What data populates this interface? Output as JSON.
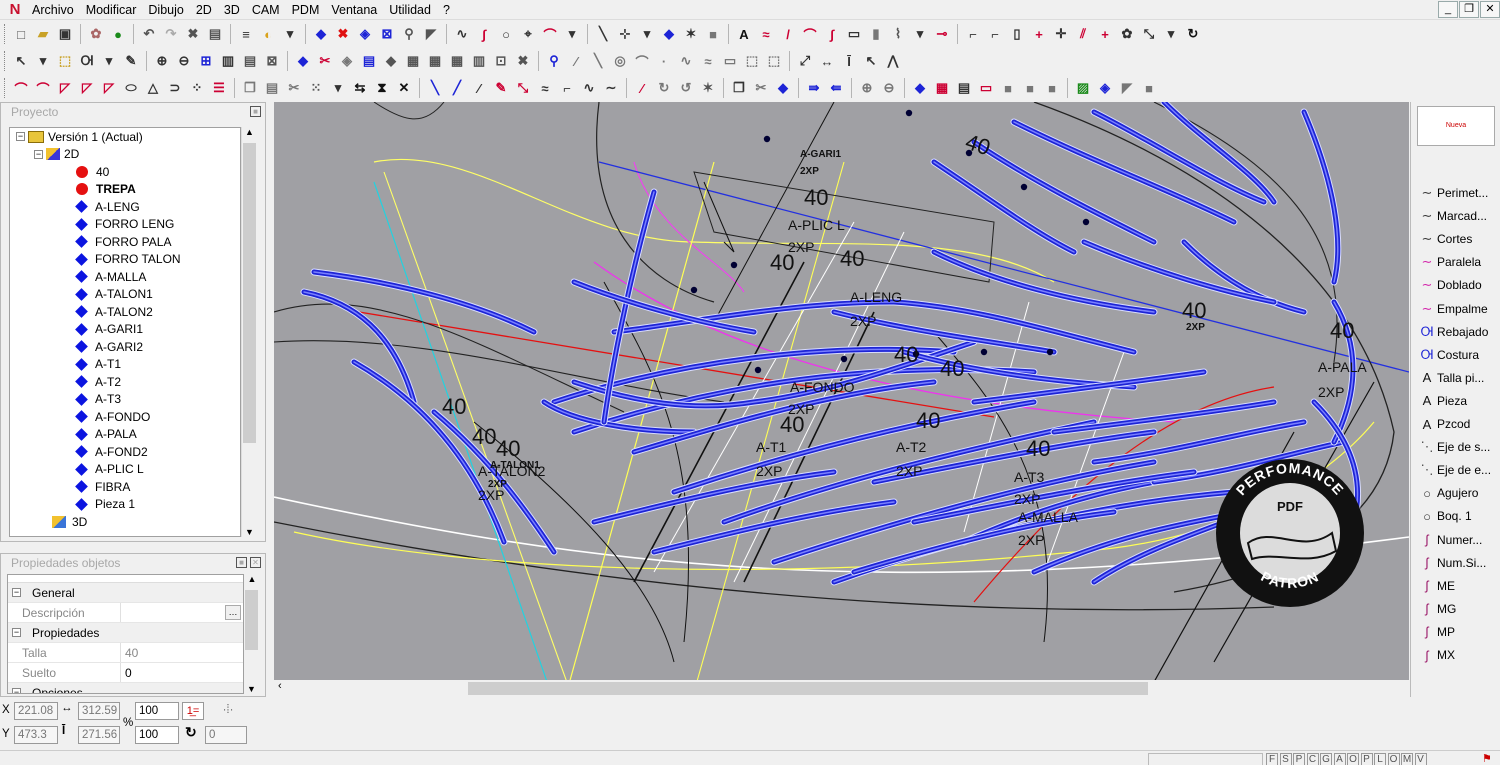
{
  "menubar": {
    "logo": "N",
    "items": [
      "Archivo",
      "Modificar",
      "Dibujo",
      "2D",
      "3D",
      "CAM",
      "PDM",
      "Ventana",
      "Utilidad",
      "?"
    ]
  },
  "project_panel": {
    "title": "Proyecto",
    "root_label": "Versión 1 (Actual)",
    "group_2d": "2D",
    "group_3d": "3D",
    "items": [
      {
        "label": "40",
        "kind": "red"
      },
      {
        "label": "TREPA",
        "kind": "red",
        "bold": true
      },
      {
        "label": "A-LENG",
        "kind": "diamond"
      },
      {
        "label": "FORRO LENG",
        "kind": "diamond"
      },
      {
        "label": "FORRO PALA",
        "kind": "diamond"
      },
      {
        "label": "FORRO TALON",
        "kind": "diamond"
      },
      {
        "label": "A-MALLA",
        "kind": "diamond"
      },
      {
        "label": "A-TALON1",
        "kind": "diamond"
      },
      {
        "label": "A-TALON2",
        "kind": "diamond"
      },
      {
        "label": "A-GARI1",
        "kind": "diamond"
      },
      {
        "label": "A-GARI2",
        "kind": "diamond"
      },
      {
        "label": "A-T1",
        "kind": "diamond"
      },
      {
        "label": "A-T2",
        "kind": "diamond"
      },
      {
        "label": "A-T3",
        "kind": "diamond"
      },
      {
        "label": "A-FONDO",
        "kind": "diamond"
      },
      {
        "label": "A-PALA",
        "kind": "diamond"
      },
      {
        "label": "A-FOND2",
        "kind": "diamond"
      },
      {
        "label": "A-PLIC L",
        "kind": "diamond"
      },
      {
        "label": "FIBRA",
        "kind": "diamond"
      },
      {
        "label": "Pieza 1",
        "kind": "diamond"
      }
    ]
  },
  "properties_panel": {
    "title": "Propiedades objetos",
    "general_label": "General",
    "descripcion_label": "Descripción",
    "descripcion_value": "",
    "propiedades_label": "Propiedades",
    "talla_label": "Talla",
    "talla_value": "40",
    "suelto_label": "Suelto",
    "suelto_value": "0",
    "opciones_label": "Opciones"
  },
  "palette": {
    "preview_text": "Nueva",
    "items": [
      {
        "label": "Perimet...",
        "icon": "curve-icon"
      },
      {
        "label": "Marcad...",
        "icon": "curve-icon"
      },
      {
        "label": "Cortes",
        "icon": "curve-icon"
      },
      {
        "label": "Paralela",
        "icon": "curve-icon"
      },
      {
        "label": "Doblado",
        "icon": "curve-icon"
      },
      {
        "label": "Empalme",
        "icon": "curve-icon"
      },
      {
        "label": "Rebajado",
        "icon": "stitch-icon"
      },
      {
        "label": "Costura",
        "icon": "stitch-icon"
      },
      {
        "label": "Talla pi...",
        "icon": "text-a-icon"
      },
      {
        "label": "Pieza",
        "icon": "text-a-icon"
      },
      {
        "label": "Pzcod",
        "icon": "text-a-icon"
      },
      {
        "label": "Eje de s...",
        "icon": "axis-icon"
      },
      {
        "label": "Eje de e...",
        "icon": "axis-icon"
      },
      {
        "label": "Agujero",
        "icon": "circle-icon"
      },
      {
        "label": "Boq. 1",
        "icon": "circle-icon"
      },
      {
        "label": "Numer...",
        "icon": "pen-icon"
      },
      {
        "label": "Num.Si...",
        "icon": "pen-icon"
      },
      {
        "label": "ME",
        "icon": "pen-icon"
      },
      {
        "label": "MG",
        "icon": "pen-icon"
      },
      {
        "label": "MP",
        "icon": "pen-icon"
      },
      {
        "label": "MX",
        "icon": "pen-icon"
      }
    ]
  },
  "coords": {
    "x_label": "X",
    "y_label": "Y",
    "x_value": "221.08",
    "y_value": "473.3",
    "dx_value": "312.59",
    "dy_value": "271.56",
    "percent_symbol": "%",
    "zoom_x": "100",
    "zoom_y": "100",
    "angle_value": "0"
  },
  "canvas": {
    "labels": [
      {
        "text": "A-GARI1",
        "size": "small"
      },
      {
        "text": "2XP",
        "size": "small"
      },
      {
        "text": "40",
        "size": "big"
      },
      {
        "text": "A-PLIC L",
        "size": "mid"
      },
      {
        "text": "2XP",
        "size": "mid"
      },
      {
        "text": "40",
        "size": "big"
      },
      {
        "text": "40",
        "size": "big"
      },
      {
        "text": "40",
        "size": "big"
      },
      {
        "text": "A-LENG",
        "size": "mid"
      },
      {
        "text": "2XP",
        "size": "mid"
      },
      {
        "text": "40",
        "size": "big"
      },
      {
        "text": "40",
        "size": "big"
      },
      {
        "text": "A-FONDO",
        "size": "mid"
      },
      {
        "text": "2XP",
        "size": "mid"
      },
      {
        "text": "40",
        "size": "big"
      },
      {
        "text": "40",
        "size": "big"
      },
      {
        "text": "A-T1",
        "size": "mid"
      },
      {
        "text": "2XP",
        "size": "mid"
      },
      {
        "text": "A-T2",
        "size": "mid"
      },
      {
        "text": "2XP",
        "size": "mid"
      },
      {
        "text": "40",
        "size": "big"
      },
      {
        "text": "A-T3",
        "size": "mid"
      },
      {
        "text": "2XP",
        "size": "mid"
      },
      {
        "text": "A-MALLA",
        "size": "mid"
      },
      {
        "text": "2XP",
        "size": "mid"
      },
      {
        "text": "40",
        "size": "big"
      },
      {
        "text": "40",
        "size": "big"
      },
      {
        "text": "40",
        "size": "big"
      },
      {
        "text": "A-TALON1",
        "size": "small"
      },
      {
        "text": "A-TALON2",
        "size": "mid"
      },
      {
        "text": "2XP",
        "size": "small"
      },
      {
        "text": "2XP",
        "size": "mid"
      },
      {
        "text": "40",
        "size": "big"
      },
      {
        "text": "A-PALA",
        "size": "mid"
      },
      {
        "text": "2XP",
        "size": "mid"
      },
      {
        "text": "40",
        "size": "big"
      },
      {
        "text": "2XP",
        "size": "small"
      }
    ]
  },
  "watermark": {
    "top_text": "PERFOMANCE",
    "bottom_text": "PATRON",
    "center_text": "PDF"
  },
  "status_letters": [
    "F",
    "S",
    "P",
    "C",
    "G",
    "A",
    "O",
    "P",
    "L",
    "O",
    "M",
    "V"
  ],
  "colors": {
    "canvas_bg": "#a0a0a4",
    "piece_blue": "#1d24d6",
    "tree_diamond": "#0b14e0",
    "tree_red_dot": "#e51010"
  }
}
